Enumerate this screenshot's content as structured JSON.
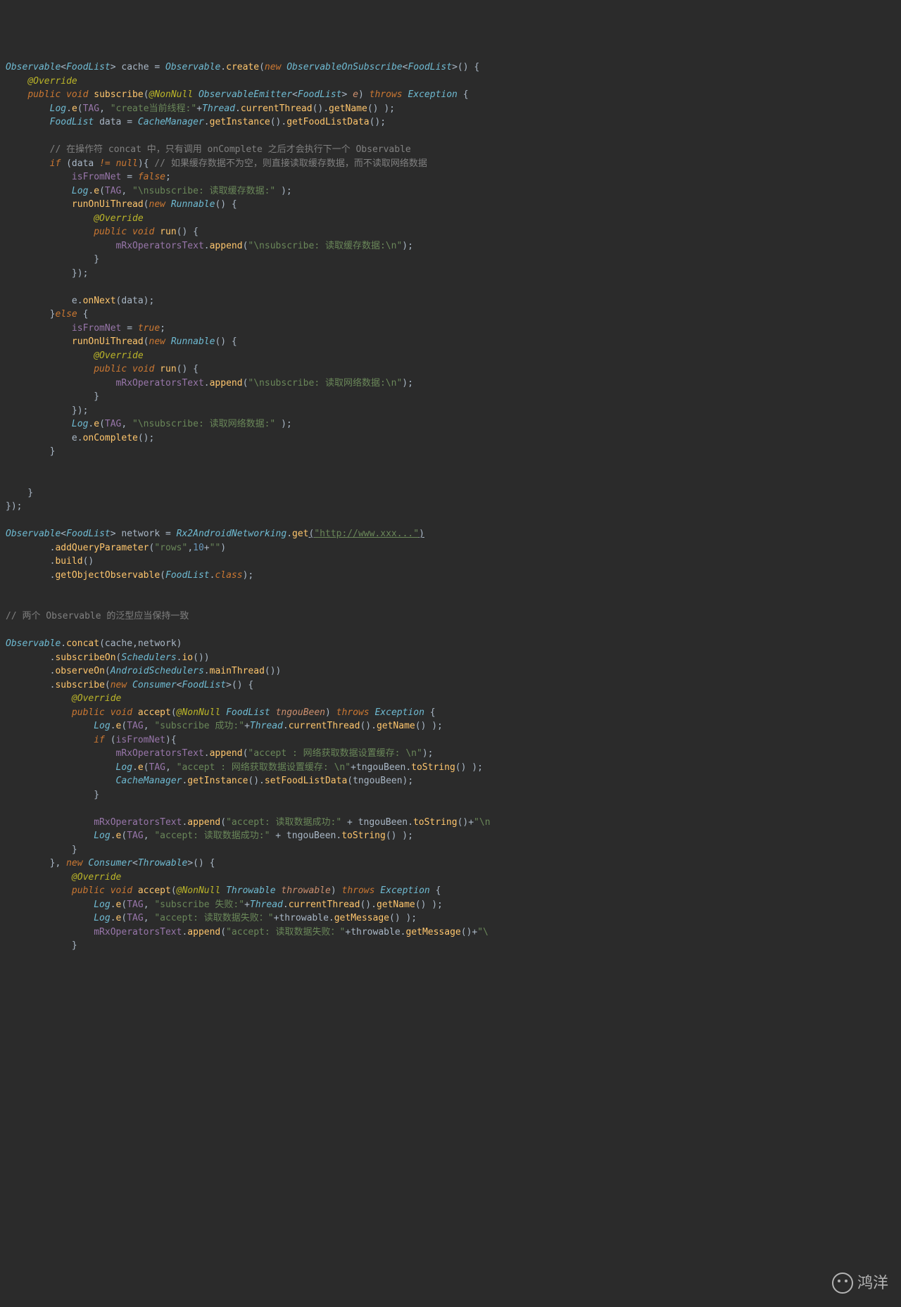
{
  "code": {
    "l01_a": "Observable",
    "l01_b": "<",
    "l01_c": "FoodList",
    "l01_d": "> cache = ",
    "l01_e": "Observable",
    "l01_f": ".",
    "l01_g": "create",
    "l01_h": "(",
    "l01_i": "new ",
    "l01_j": "ObservableOnSubscribe",
    "l01_k": "<",
    "l01_l": "FoodList",
    "l01_m": ">() {",
    "l02_a": "    ",
    "l02_b": "@Override",
    "l03_a": "    ",
    "l03_b": "public ",
    "l03_c": "void ",
    "l03_d": "subscribe",
    "l03_e": "(",
    "l03_f": "@NonNull ",
    "l03_g": "ObservableEmitter",
    "l03_h": "<",
    "l03_i": "FoodList",
    "l03_j": "> ",
    "l03_k": "e",
    "l03_l": ") ",
    "l03_m": "throws ",
    "l03_n": "Exception ",
    "l03_o": "{",
    "l04_a": "        ",
    "l04_b": "Log",
    "l04_c": ".",
    "l04_d": "e",
    "l04_e": "(",
    "l04_f": "TAG",
    "l04_g": ", ",
    "l04_h": "\"create当前线程:\"",
    "l04_i": "+",
    "l04_j": "Thread",
    "l04_k": ".",
    "l04_l": "currentThread",
    "l04_m": "().",
    "l04_n": "getName",
    "l04_o": "() );",
    "l05_a": "        ",
    "l05_b": "FoodList ",
    "l05_c": "data = ",
    "l05_d": "CacheManager",
    "l05_e": ".",
    "l05_f": "getInstance",
    "l05_g": "().",
    "l05_h": "getFoodListData",
    "l05_i": "();",
    "l06": "",
    "l07_a": "        ",
    "l07_b": "// 在操作符 concat 中，只有调用 onComplete 之后才会执行下一个 Observable",
    "l08_a": "        ",
    "l08_b": "if ",
    "l08_c": "(data ",
    "l08_d": "!= ",
    "l08_e": "null",
    "l08_f": "){ ",
    "l08_g": "// 如果缓存数据不为空，则直接读取缓存数据，而不读取网络数据",
    "l09_a": "            ",
    "l09_b": "isFromNet ",
    "l09_c": "= ",
    "l09_d": "false",
    "l09_e": ";",
    "l10_a": "            ",
    "l10_b": "Log",
    "l10_c": ".",
    "l10_d": "e",
    "l10_e": "(",
    "l10_f": "TAG",
    "l10_g": ", ",
    "l10_h": "\"\\nsubscribe: 读取缓存数据:\" ",
    "l10_i": ");",
    "l11_a": "            ",
    "l11_b": "runOnUiThread",
    "l11_c": "(",
    "l11_d": "new ",
    "l11_e": "Runnable",
    "l11_f": "() {",
    "l12_a": "                ",
    "l12_b": "@Override",
    "l13_a": "                ",
    "l13_b": "public ",
    "l13_c": "void ",
    "l13_d": "run",
    "l13_e": "() {",
    "l14_a": "                    ",
    "l14_b": "mRxOperatorsText",
    "l14_c": ".",
    "l14_d": "append",
    "l14_e": "(",
    "l14_f": "\"\\nsubscribe: 读取缓存数据:\\n\"",
    "l14_g": ");",
    "l15_a": "                }",
    "l16_a": "            });",
    "l17": "",
    "l18_a": "            e.",
    "l18_b": "onNext",
    "l18_c": "(data);",
    "l19_a": "        }",
    "l19_b": "else ",
    "l19_c": "{",
    "l20_a": "            ",
    "l20_b": "isFromNet ",
    "l20_c": "= ",
    "l20_d": "true",
    "l20_e": ";",
    "l21_a": "            ",
    "l21_b": "runOnUiThread",
    "l21_c": "(",
    "l21_d": "new ",
    "l21_e": "Runnable",
    "l21_f": "() {",
    "l22_a": "                ",
    "l22_b": "@Override",
    "l23_a": "                ",
    "l23_b": "public ",
    "l23_c": "void ",
    "l23_d": "run",
    "l23_e": "() {",
    "l24_a": "                    ",
    "l24_b": "mRxOperatorsText",
    "l24_c": ".",
    "l24_d": "append",
    "l24_e": "(",
    "l24_f": "\"\\nsubscribe: 读取网络数据:\\n\"",
    "l24_g": ");",
    "l25_a": "                }",
    "l26_a": "            });",
    "l27_a": "            ",
    "l27_b": "Log",
    "l27_c": ".",
    "l27_d": "e",
    "l27_e": "(",
    "l27_f": "TAG",
    "l27_g": ", ",
    "l27_h": "\"\\nsubscribe: 读取网络数据:\" ",
    "l27_i": ");",
    "l28_a": "            e.",
    "l28_b": "onComplete",
    "l28_c": "();",
    "l29_a": "        }",
    "l30": "",
    "l31": "",
    "l32_a": "    }",
    "l33_a": "});",
    "l34": "",
    "l35_a": "Observable",
    "l35_b": "<",
    "l35_c": "FoodList",
    "l35_d": "> network = ",
    "l35_e": "Rx2AndroidNetworking",
    "l35_f": ".",
    "l35_g": "get",
    "l35_h": "(",
    "l35_i": "\"http://www.xxx...\"",
    "l35_j": ")",
    "l36_a": "        .",
    "l36_b": "addQueryParameter",
    "l36_c": "(",
    "l36_d": "\"rows\"",
    "l36_e": ",",
    "l36_f": "10",
    "l36_g": "+",
    "l36_h": "\"\"",
    "l36_i": ")",
    "l37_a": "        .",
    "l37_b": "build",
    "l37_c": "()",
    "l38_a": "        .",
    "l38_b": "getObjectObservable",
    "l38_c": "(",
    "l38_d": "FoodList",
    "l38_e": ".",
    "l38_f": "class",
    "l38_g": ");",
    "l39": "",
    "l40": "",
    "l41_a": "// 两个 Observable 的泛型应当保持一致",
    "l42": "",
    "l43_a": "Observable",
    "l43_b": ".",
    "l43_c": "concat",
    "l43_d": "(cache,network)",
    "l44_a": "        .",
    "l44_b": "subscribeOn",
    "l44_c": "(",
    "l44_d": "Schedulers",
    "l44_e": ".",
    "l44_f": "io",
    "l44_g": "())",
    "l45_a": "        .",
    "l45_b": "observeOn",
    "l45_c": "(",
    "l45_d": "AndroidSchedulers",
    "l45_e": ".",
    "l45_f": "mainThread",
    "l45_g": "())",
    "l46_a": "        .",
    "l46_b": "subscribe",
    "l46_c": "(",
    "l46_d": "new ",
    "l46_e": "Consumer",
    "l46_f": "<",
    "l46_g": "FoodList",
    "l46_h": ">() {",
    "l47_a": "            ",
    "l47_b": "@Override",
    "l48_a": "            ",
    "l48_b": "public ",
    "l48_c": "void ",
    "l48_d": "accept",
    "l48_e": "(",
    "l48_f": "@NonNull ",
    "l48_g": "FoodList ",
    "l48_h": "tngouBeen",
    "l48_i": ") ",
    "l48_j": "throws ",
    "l48_k": "Exception ",
    "l48_l": "{",
    "l49_a": "                ",
    "l49_b": "Log",
    "l49_c": ".",
    "l49_d": "e",
    "l49_e": "(",
    "l49_f": "TAG",
    "l49_g": ", ",
    "l49_h": "\"subscribe 成功:\"",
    "l49_i": "+",
    "l49_j": "Thread",
    "l49_k": ".",
    "l49_l": "currentThread",
    "l49_m": "().",
    "l49_n": "getName",
    "l49_o": "() );",
    "l50_a": "                ",
    "l50_b": "if ",
    "l50_c": "(",
    "l50_d": "isFromNet",
    "l50_e": "){",
    "l51_a": "                    ",
    "l51_b": "mRxOperatorsText",
    "l51_c": ".",
    "l51_d": "append",
    "l51_e": "(",
    "l51_f": "\"accept : 网络获取数据设置缓存: \\n\"",
    "l51_g": ");",
    "l52_a": "                    ",
    "l52_b": "Log",
    "l52_c": ".",
    "l52_d": "e",
    "l52_e": "(",
    "l52_f": "TAG",
    "l52_g": ", ",
    "l52_h": "\"accept : 网络获取数据设置缓存: \\n\"",
    "l52_i": "+tngouBeen.",
    "l52_j": "toString",
    "l52_k": "() );",
    "l53_a": "                    ",
    "l53_b": "CacheManager",
    "l53_c": ".",
    "l53_d": "getInstance",
    "l53_e": "().",
    "l53_f": "setFoodListData",
    "l53_g": "(tngouBeen);",
    "l54_a": "                }",
    "l55": "",
    "l56_a": "                ",
    "l56_b": "mRxOperatorsText",
    "l56_c": ".",
    "l56_d": "append",
    "l56_e": "(",
    "l56_f": "\"accept: 读取数据成功:\"",
    "l56_g": " + tngouBeen.",
    "l56_h": "toString",
    "l56_i": "()+",
    "l56_j": "\"\\n",
    "l57_a": "                ",
    "l57_b": "Log",
    "l57_c": ".",
    "l57_d": "e",
    "l57_e": "(",
    "l57_f": "TAG",
    "l57_g": ", ",
    "l57_h": "\"accept: 读取数据成功:\"",
    "l57_i": " + tngouBeen.",
    "l57_j": "toString",
    "l57_k": "() );",
    "l58_a": "            }",
    "l59_a": "        }, ",
    "l59_b": "new ",
    "l59_c": "Consumer",
    "l59_d": "<",
    "l59_e": "Throwable",
    "l59_f": ">() {",
    "l60_a": "            ",
    "l60_b": "@Override",
    "l61_a": "            ",
    "l61_b": "public ",
    "l61_c": "void ",
    "l61_d": "accept",
    "l61_e": "(",
    "l61_f": "@NonNull ",
    "l61_g": "Throwable ",
    "l61_h": "throwable",
    "l61_i": ") ",
    "l61_j": "throws ",
    "l61_k": "Exception ",
    "l61_l": "{",
    "l62_a": "                ",
    "l62_b": "Log",
    "l62_c": ".",
    "l62_d": "e",
    "l62_e": "(",
    "l62_f": "TAG",
    "l62_g": ", ",
    "l62_h": "\"subscribe 失败:\"",
    "l62_i": "+",
    "l62_j": "Thread",
    "l62_k": ".",
    "l62_l": "currentThread",
    "l62_m": "().",
    "l62_n": "getName",
    "l62_o": "() );",
    "l63_a": "                ",
    "l63_b": "Log",
    "l63_c": ".",
    "l63_d": "e",
    "l63_e": "(",
    "l63_f": "TAG",
    "l63_g": ", ",
    "l63_h": "\"accept: 读取数据失败：\"",
    "l63_i": "+throwable.",
    "l63_j": "getMessage",
    "l63_k": "() );",
    "l64_a": "                ",
    "l64_b": "mRxOperatorsText",
    "l64_c": ".",
    "l64_d": "append",
    "l64_e": "(",
    "l64_f": "\"accept: 读取数据失败：\"",
    "l64_g": "+throwable.",
    "l64_h": "getMessage",
    "l64_i": "()+",
    "l64_j": "\"\\",
    "l65_a": "            }"
  },
  "watermark": "鸿洋"
}
